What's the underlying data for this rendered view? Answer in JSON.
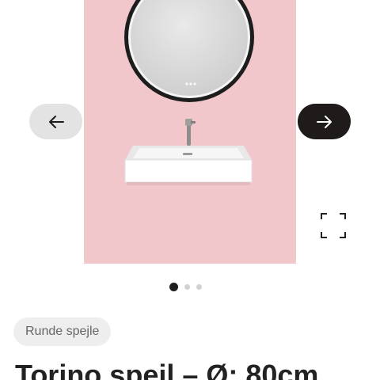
{
  "gallery": {
    "image_subject": "mirror-and-sink-photo",
    "background_color": "#f2c7cc",
    "prev_icon": "arrow-left-icon",
    "next_icon": "arrow-right-icon",
    "fullscreen_icon": "fullscreen-icon",
    "slide_count": 3,
    "active_slide": 1
  },
  "product": {
    "category_tag": "Runde spejle",
    "title": "Torino spejl – Ø: 80cm"
  },
  "colors": {
    "accent_dark": "#1f1b1a",
    "nav_light": "#e3e3e3",
    "tag_bg": "#eeeeee"
  }
}
